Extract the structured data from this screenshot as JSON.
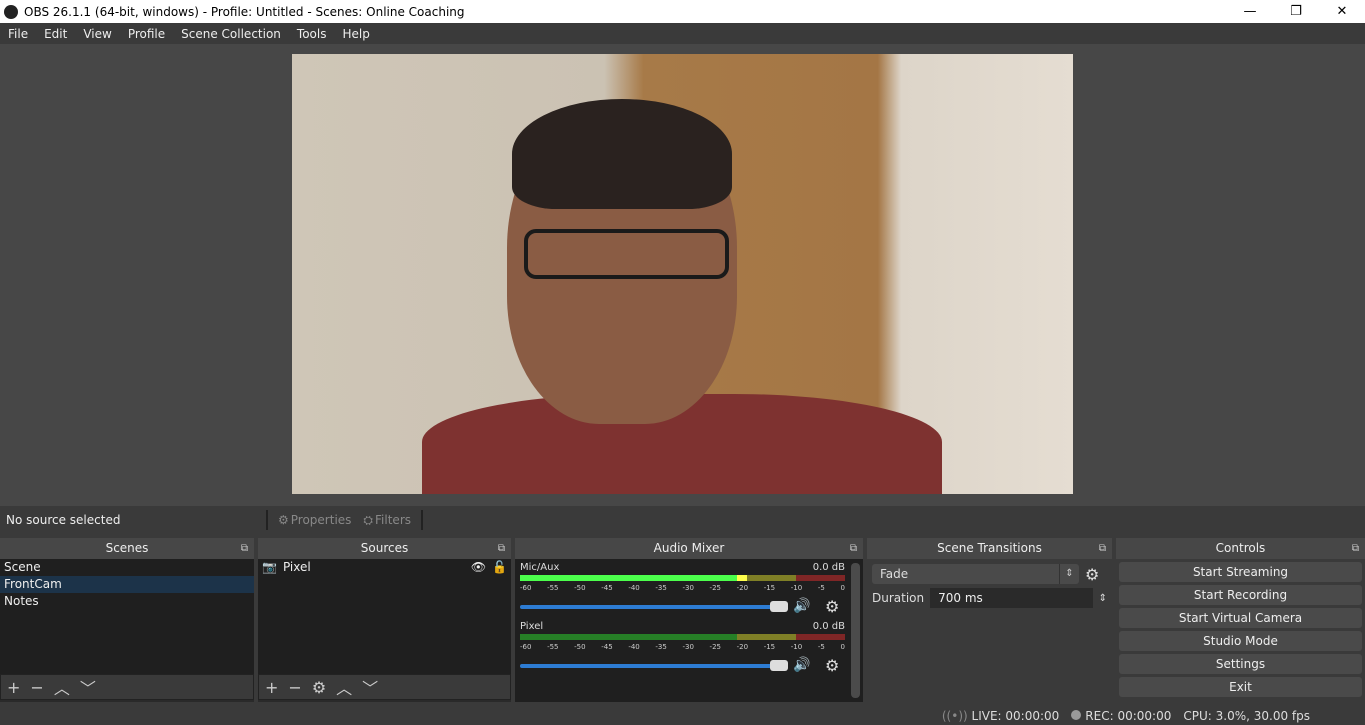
{
  "window": {
    "title": "OBS 26.1.1 (64-bit, windows) - Profile: Untitled - Scenes: Online Coaching",
    "minimize": "—",
    "restore": "❐",
    "close": "✕"
  },
  "menu": [
    "File",
    "Edit",
    "View",
    "Profile",
    "Scene Collection",
    "Tools",
    "Help"
  ],
  "source_toolbar": {
    "status": "No source selected",
    "properties": "Properties",
    "filters": "Filters"
  },
  "scenes": {
    "title": "Scenes",
    "items": [
      {
        "label": "Scene",
        "selected": false
      },
      {
        "label": "FrontCam",
        "selected": true
      },
      {
        "label": "Notes",
        "selected": false
      }
    ]
  },
  "sources": {
    "title": "Sources",
    "items": [
      {
        "label": "Pixel",
        "visible": true,
        "locked": false
      }
    ]
  },
  "audio_mixer": {
    "title": "Audio Mixer",
    "channels": [
      {
        "name": "Mic/Aux",
        "db": "0.0 dB",
        "volume_percent": 100,
        "meter_level_db": -16
      },
      {
        "name": "Pixel",
        "db": "0.0 dB",
        "volume_percent": 100,
        "meter_level_db": -60
      }
    ],
    "ticks": [
      "-60",
      "-55",
      "-50",
      "-45",
      "-40",
      "-35",
      "-30",
      "-25",
      "-20",
      "-15",
      "-10",
      "-5",
      "0"
    ]
  },
  "transitions": {
    "title": "Scene Transitions",
    "selected": "Fade",
    "duration_label": "Duration",
    "duration": "700 ms"
  },
  "controls": {
    "title": "Controls",
    "buttons": [
      "Start Streaming",
      "Start Recording",
      "Start Virtual Camera",
      "Studio Mode",
      "Settings",
      "Exit"
    ]
  },
  "status": {
    "live": "LIVE: 00:00:00",
    "rec": "REC: 00:00:00",
    "cpu": "CPU: 3.0%, 30.00 fps"
  },
  "colors": {
    "meter_green": "#4cff4c",
    "meter_yellow": "#ffff4c",
    "meter_red": "#ff4c4c",
    "slider": "#2d7cd3",
    "selection": "#1c3349"
  }
}
